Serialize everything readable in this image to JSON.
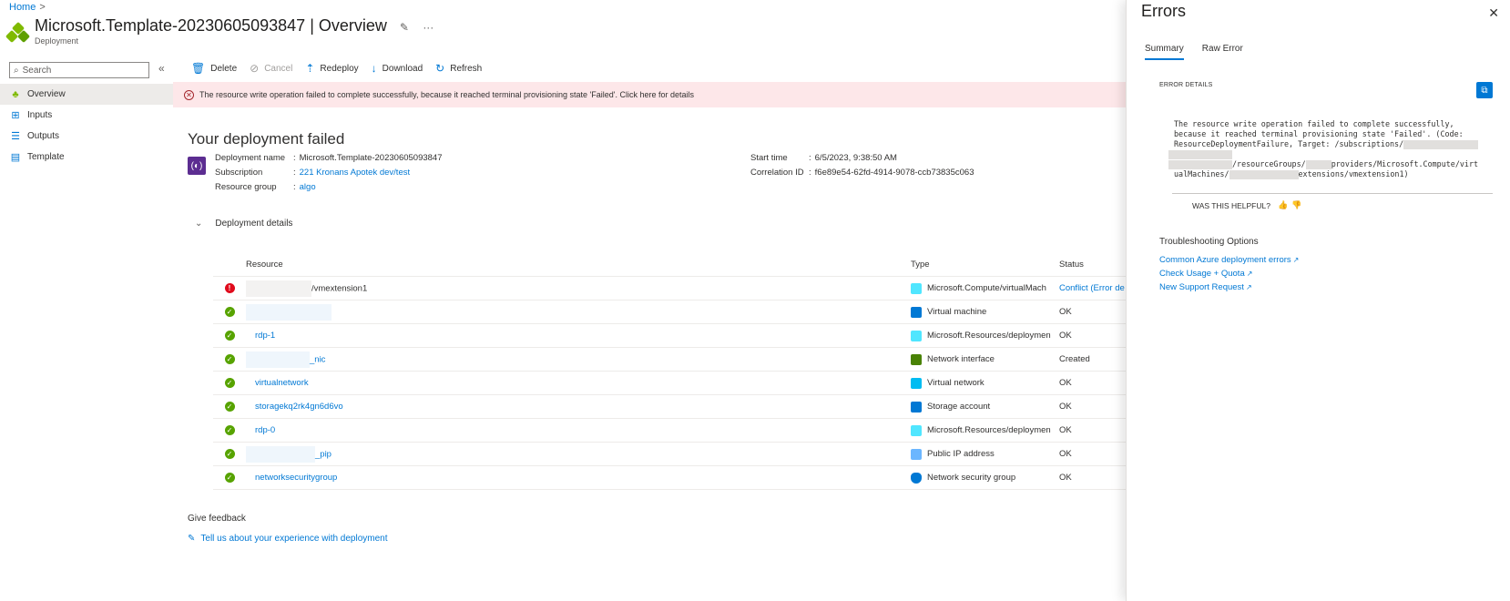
{
  "breadcrumb": {
    "home": "Home",
    "sep": ">"
  },
  "header": {
    "title": "Microsoft.Template-20230605093847",
    "section": " | Overview",
    "subtitle": "Deployment"
  },
  "search": {
    "placeholder": "Search"
  },
  "sidebar": {
    "items": [
      {
        "label": "Overview",
        "icon": "deployment-icon"
      },
      {
        "label": "Inputs",
        "icon": "inputs-icon"
      },
      {
        "label": "Outputs",
        "icon": "outputs-icon"
      },
      {
        "label": "Template",
        "icon": "template-icon"
      }
    ]
  },
  "toolbar": {
    "delete": "Delete",
    "cancel": "Cancel",
    "redeploy": "Redeploy",
    "download": "Download",
    "refresh": "Refresh"
  },
  "banner": {
    "text": "The resource write operation failed to complete successfully, because it reached terminal provisioning state 'Failed'. Click here for details"
  },
  "summary": {
    "heading": "Your deployment failed",
    "deployment_name_label": "Deployment name",
    "deployment_name": "Microsoft.Template-20230605093847",
    "subscription_label": "Subscription",
    "subscription": "221 Kronans Apotek dev/test",
    "resource_group_label": "Resource group",
    "resource_group": "algo",
    "start_time_label": "Start time",
    "start_time": "6/5/2023, 9:38:50 AM",
    "correlation_label": "Correlation ID",
    "correlation_id": "f6e89e54-62fd-4914-9078-ccb73835c063",
    "colon": ":"
  },
  "details": {
    "toggle": "Deployment details",
    "columns": {
      "resource": "Resource",
      "type": "Type",
      "status": "Status"
    },
    "rows": [
      {
        "resource": "/vmextension1",
        "type": "Microsoft.Compute/virtualMach",
        "status": "Conflict (Error de",
        "state": "error",
        "type_color": "#50e6ff"
      },
      {
        "resource": "",
        "type": "Virtual machine",
        "status": "OK",
        "state": "ok",
        "type_color": "#0078d4"
      },
      {
        "resource": "rdp-1",
        "type": "Microsoft.Resources/deploymen",
        "status": "OK",
        "state": "ok",
        "type_color": "#50e6ff"
      },
      {
        "resource": "_nic",
        "type": "Network interface",
        "status": "Created",
        "state": "ok",
        "type_color": "#498205"
      },
      {
        "resource": "virtualnetwork",
        "type": "Virtual network",
        "status": "OK",
        "state": "ok",
        "type_color": "#00bcf2"
      },
      {
        "resource": "storagekq2rk4gn6d6vo",
        "type": "Storage account",
        "status": "OK",
        "state": "ok",
        "type_color": "#0078d4"
      },
      {
        "resource": "rdp-0",
        "type": "Microsoft.Resources/deploymen",
        "status": "OK",
        "state": "ok",
        "type_color": "#50e6ff"
      },
      {
        "resource": "_pip",
        "type": "Public IP address",
        "status": "OK",
        "state": "ok",
        "type_color": "#6bb6ff"
      },
      {
        "resource": "networksecuritygroup",
        "type": "Network security group",
        "status": "OK",
        "state": "ok",
        "type_color": "#0078d4"
      }
    ]
  },
  "feedback": {
    "title": "Give feedback",
    "link": "Tell us about your experience with deployment"
  },
  "errors_panel": {
    "title": "Errors",
    "tabs": [
      "Summary",
      "Raw Error"
    ],
    "section": "ERROR DETAILS",
    "msg_line1": "The resource write operation failed to complete successfully,",
    "msg_line2": "because it reached terminal provisioning state 'Failed'. (Code:",
    "msg_line3": "ResourceDeploymentFailure, Target: /subscriptions/",
    "msg_line4a": "/resourceGroups/",
    "msg_line4b": "providers/Microsoft.Compute/virt",
    "msg_line5a": "ualMachines/",
    "msg_line5b": "extensions/vmextension1)",
    "helpful": "WAS THIS HELPFUL?",
    "troubleshooting": "Troubleshooting Options",
    "links": [
      "Common Azure deployment errors",
      "Check Usage + Quota",
      "New Support Request"
    ]
  },
  "colors": {
    "accent": "#0078d4",
    "error": "#e00b1c",
    "success": "#57a300",
    "banner_bg": "#fde7e9"
  }
}
